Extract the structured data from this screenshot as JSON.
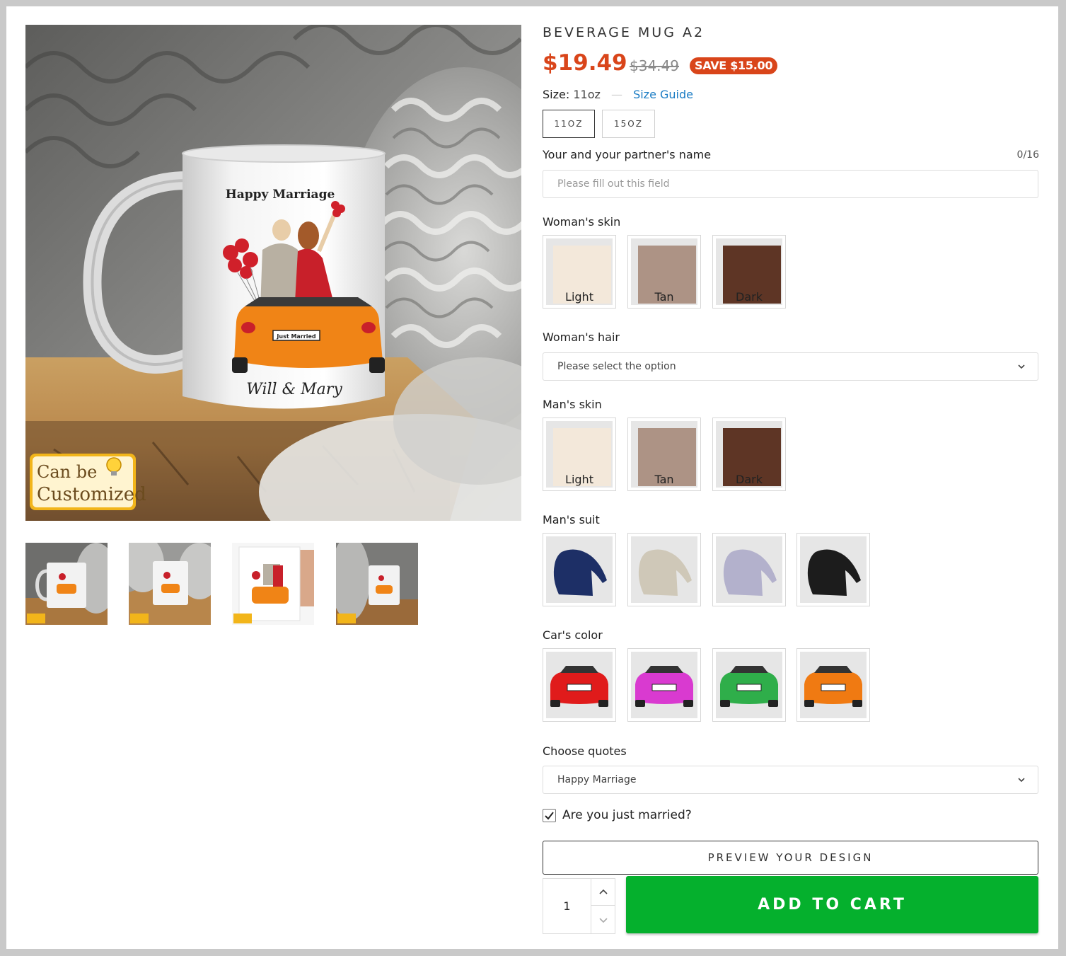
{
  "product": {
    "title": "BEVERAGE MUG A2",
    "price": "$19.49",
    "compare_price": "$34.49",
    "save_badge": "SAVE $15.00"
  },
  "mug_art": {
    "header": "Happy Marriage",
    "plate": "Just Married",
    "names": "Will & Mary"
  },
  "badge": {
    "line1": "Can be",
    "line2": "Customized"
  },
  "size": {
    "label": "Size:",
    "value": "11oz",
    "guide_label": "Size Guide",
    "options": [
      "11OZ",
      "15OZ"
    ],
    "selected": "11OZ"
  },
  "name_field": {
    "label": "Your and your partner's name",
    "counter": "0/16",
    "placeholder": "Please fill out this field",
    "value": ""
  },
  "woman_skin": {
    "label": "Woman's skin",
    "options": [
      {
        "label": "Light",
        "color": "#f3e8da"
      },
      {
        "label": "Tan",
        "color": "#ad9385"
      },
      {
        "label": "Dark",
        "color": "#5e3525"
      }
    ]
  },
  "woman_hair": {
    "label": "Woman's hair",
    "value": "Please select the option"
  },
  "man_skin": {
    "label": "Man's skin",
    "options": [
      {
        "label": "Light",
        "color": "#f3e8da"
      },
      {
        "label": "Tan",
        "color": "#ad9385"
      },
      {
        "label": "Dark",
        "color": "#5e3525"
      }
    ]
  },
  "man_suit": {
    "label": "Man's suit",
    "options": [
      {
        "name": "navy-suit-icon",
        "color": "#1d2f66"
      },
      {
        "name": "beige-suit-icon",
        "color": "#cfc8b8"
      },
      {
        "name": "lavender-suit-icon",
        "color": "#b3b1cc"
      },
      {
        "name": "black-suit-icon",
        "color": "#1c1c1c"
      }
    ]
  },
  "car_color": {
    "label": "Car's color",
    "options": [
      {
        "name": "red-car-icon",
        "color": "#e01b1b"
      },
      {
        "name": "pink-car-icon",
        "color": "#d93ad0"
      },
      {
        "name": "green-car-icon",
        "color": "#2fae4a"
      },
      {
        "name": "orange-car-icon",
        "color": "#f07a12"
      }
    ]
  },
  "quotes": {
    "label": "Choose quotes",
    "value": "Happy Marriage"
  },
  "just_married": {
    "label": "Are you just married?",
    "checked": true
  },
  "actions": {
    "preview": "PREVIEW YOUR DESIGN",
    "add_to_cart": "ADD TO CART",
    "quantity": "1"
  },
  "colors": {
    "price": "#d9451a",
    "link": "#1a7cc4",
    "cart": "#05b02d"
  }
}
